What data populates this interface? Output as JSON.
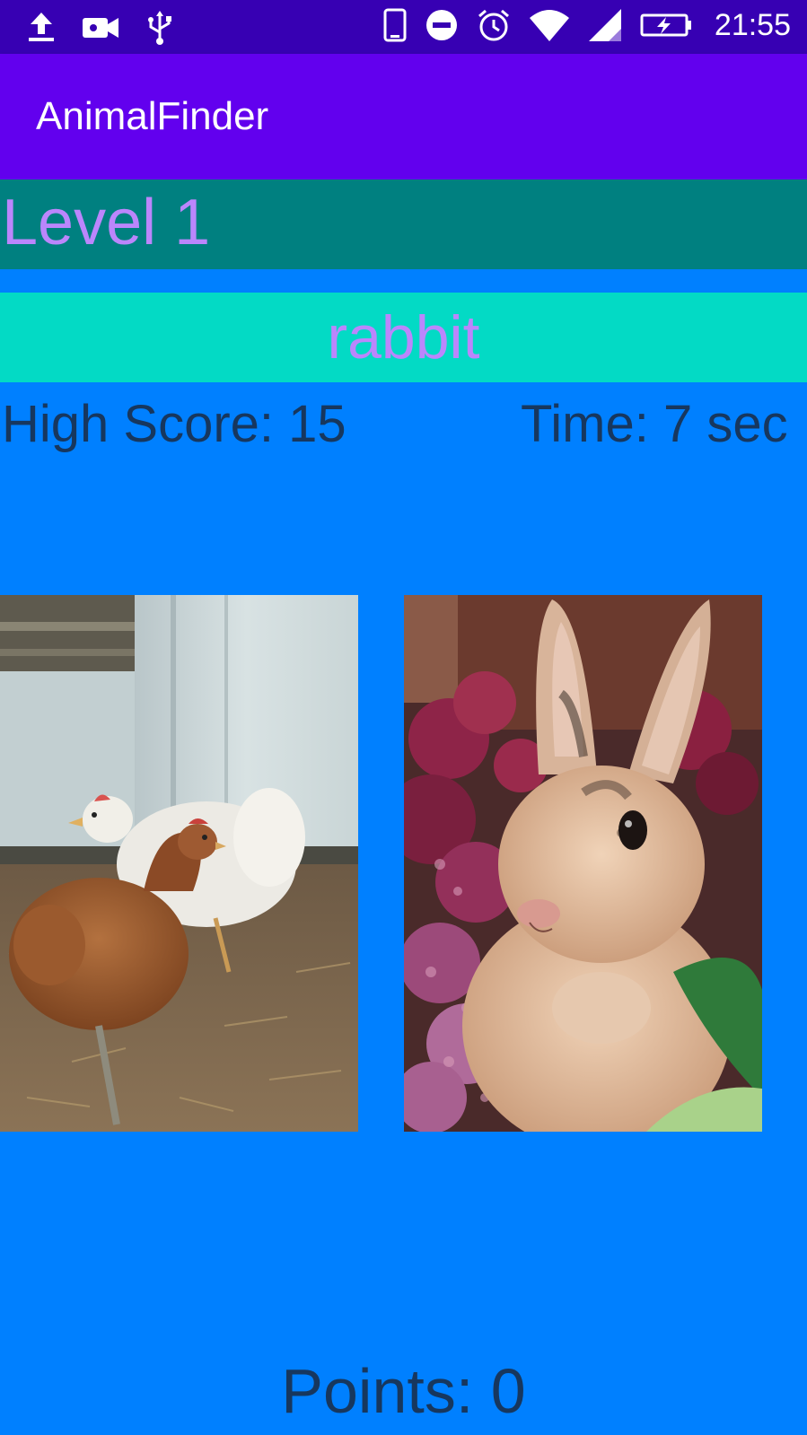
{
  "status_bar": {
    "time": "21:55",
    "left_icons": [
      "upload-icon",
      "video-camera-icon",
      "usb-icon"
    ],
    "right_icons": [
      "phone-icon",
      "do-not-disturb-icon",
      "alarm-clock-icon",
      "wifi-icon",
      "signal-icon",
      "battery-charging-icon"
    ]
  },
  "app_bar": {
    "title": "AnimalFinder"
  },
  "game": {
    "level": "Level 1",
    "target_animal": "rabbit",
    "high_score": "High Score: 15",
    "timer": "Time: 7 sec",
    "points": "Points: 0"
  },
  "choices": [
    {
      "animal": "chicken",
      "image": "chicken-photo"
    },
    {
      "animal": "rabbit",
      "image": "rabbit-photo"
    }
  ],
  "colors": {
    "status_bar": "#3700B3",
    "app_bar": "#6200EE",
    "background": "#0080FF",
    "level_bar": "#008080",
    "target_bar": "#03DAC5",
    "accent_text": "#BB86FC",
    "score_text": "#17375E"
  }
}
